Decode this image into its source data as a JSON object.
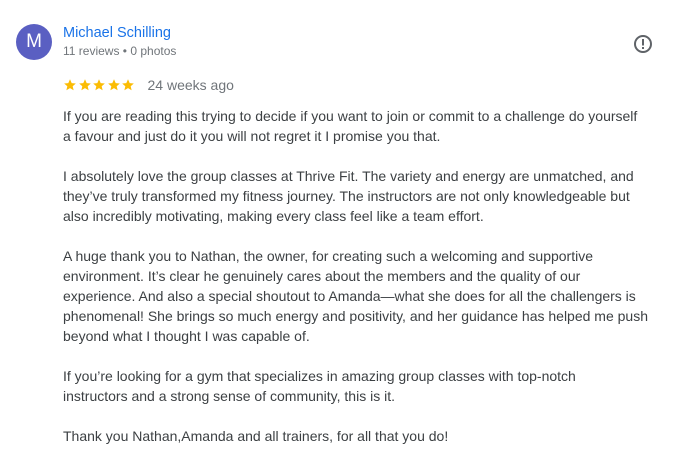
{
  "author": {
    "initial": "M",
    "name": "Michael Schilling",
    "meta": "11 reviews • 0 photos",
    "avatar_color": "#5a5fc2"
  },
  "report_icon": "report-flag-icon",
  "rating": {
    "stars": 5,
    "max": 5,
    "star_color": "#fbbc04",
    "date": "24 weeks ago"
  },
  "review": {
    "paragraphs": [
      "If you are reading this trying to decide if you want to join or commit to a challenge do yourself\na favour and just do it you will not regret it I promise you that.",
      "I absolutely love the group classes at Thrive Fit. The variety and energy are unmatched, and\nthey’ve truly transformed my fitness journey. The instructors are not only knowledgeable but\nalso incredibly motivating, making every class feel like a team effort.",
      "A huge thank you to Nathan, the owner, for creating such a welcoming and supportive\nenvironment. It’s clear he genuinely cares about the members and the quality of our\nexperience. And also a special shoutout to Amanda—what she does for all the challengers is\nphenomenal! She brings so much energy and positivity, and her guidance has helped me push\nbeyond what I thought I was capable of.",
      "If you’re looking for a gym that specializes in amazing group classes with top-notch\ninstructors and a strong sense of community, this is it.",
      "Thank you Nathan,Amanda and all trainers, for all that you do!"
    ]
  }
}
